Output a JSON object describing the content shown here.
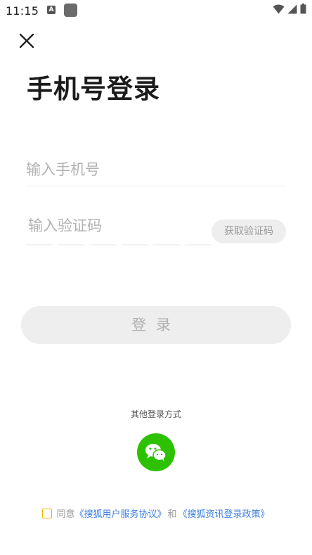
{
  "status_bar": {
    "time": "11:15",
    "notification_letter": "A"
  },
  "page": {
    "title": "手机号登录"
  },
  "form": {
    "phone_placeholder": "输入手机号",
    "code_placeholder": "输入验证码",
    "get_code_label": "获取验证码",
    "login_label": "登录"
  },
  "other_login": {
    "label": "其他登录方式"
  },
  "agreement": {
    "prefix": "同意",
    "user_agreement": "《搜狐用户服务协议》",
    "and": "和",
    "policy": "《搜狐资讯登录政策》"
  },
  "colors": {
    "wechat_green": "#2dc100",
    "link_blue": "#3b7ee0",
    "checkbox_yellow": "#e6b800"
  }
}
